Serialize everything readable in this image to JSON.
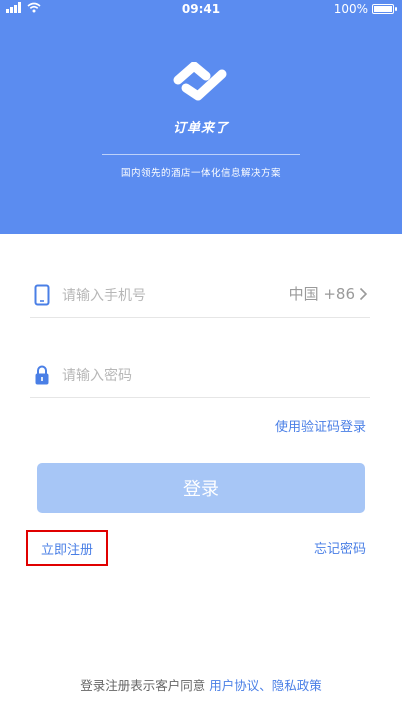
{
  "status_bar": {
    "time": "09:41",
    "battery": "100%",
    "battery_level": 1.0
  },
  "header": {
    "brand": "订单来了",
    "tagline": "国内领先的酒店一体化信息解决方案",
    "logo_icon": "brand-logo-icon",
    "background_color": "#5b8cf0"
  },
  "form": {
    "phone_placeholder": "请输入手机号",
    "country_code": "中国 +86",
    "password_placeholder": "请输入密码",
    "sms_login_label": "使用验证码登录",
    "login_label": "登录",
    "register_label": "立即注册",
    "forgot_password_label": "忘记密码"
  },
  "terms": {
    "prefix": "登录注册表示客户同意 ",
    "user_agreement": "用户协议",
    "separator": "、",
    "privacy_policy": "隐私政策"
  },
  "colors": {
    "accent": "#4a7fe6",
    "button_disabled": "#a7c6f6",
    "highlight_box": "#e00000"
  }
}
